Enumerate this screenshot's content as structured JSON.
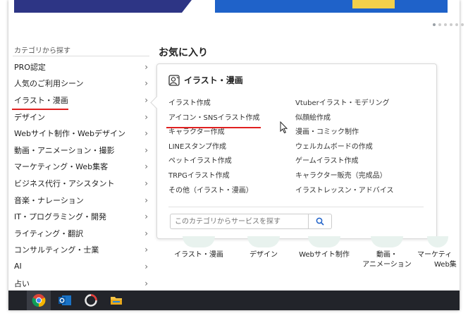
{
  "sidebar": {
    "title": "カテゴリから探す",
    "items": [
      {
        "label": "PRO認定"
      },
      {
        "label": "人気のご利用シーン"
      },
      {
        "label": "イラスト・漫画"
      },
      {
        "label": "デザイン"
      },
      {
        "label": "Webサイト制作・Webデザイン"
      },
      {
        "label": "動画・アニメーション・撮影"
      },
      {
        "label": "マーケティング・Web集客"
      },
      {
        "label": "ビジネス代行・アシスタント"
      },
      {
        "label": "音楽・ナレーション"
      },
      {
        "label": "IT・プログラミング・開発"
      },
      {
        "label": "ライティング・翻訳"
      },
      {
        "label": "コンサルティング・士業"
      },
      {
        "label": "AI"
      },
      {
        "label": "占い"
      }
    ]
  },
  "favorites": {
    "title": "お気に入り"
  },
  "popup": {
    "title": "イラスト・漫画",
    "left": [
      "イラスト作成",
      "アイコン・SNSイラスト作成",
      "キャラクター作成",
      "LINEスタンプ作成",
      "ペットイラスト作成",
      "TRPGイラスト作成",
      "その他（イラスト・漫画）"
    ],
    "right": [
      "Vtuberイラスト・モデリング",
      "似顔絵作成",
      "漫画・コミック制作",
      "ウェルカムボードの作成",
      "ゲームイラスト作成",
      "キャラクター販売（完成品）",
      "イラストレッスン・アドバイス"
    ],
    "search_placeholder": "このカテゴリからサービスを探す"
  },
  "bottom_categories": [
    {
      "line1": "イラスト・漫画",
      "line2": ""
    },
    {
      "line1": "デザイン",
      "line2": ""
    },
    {
      "line1": "Webサイト制作",
      "line2": ""
    },
    {
      "line1": "動画・",
      "line2": "アニメーション"
    },
    {
      "line1": "マーケティ",
      "line2": "Web集"
    }
  ],
  "colors": {
    "accent_red": "#e02020",
    "banner_dark": "#2d3585",
    "banner_blue": "#1f62c9",
    "taskbar": "#22242a"
  }
}
